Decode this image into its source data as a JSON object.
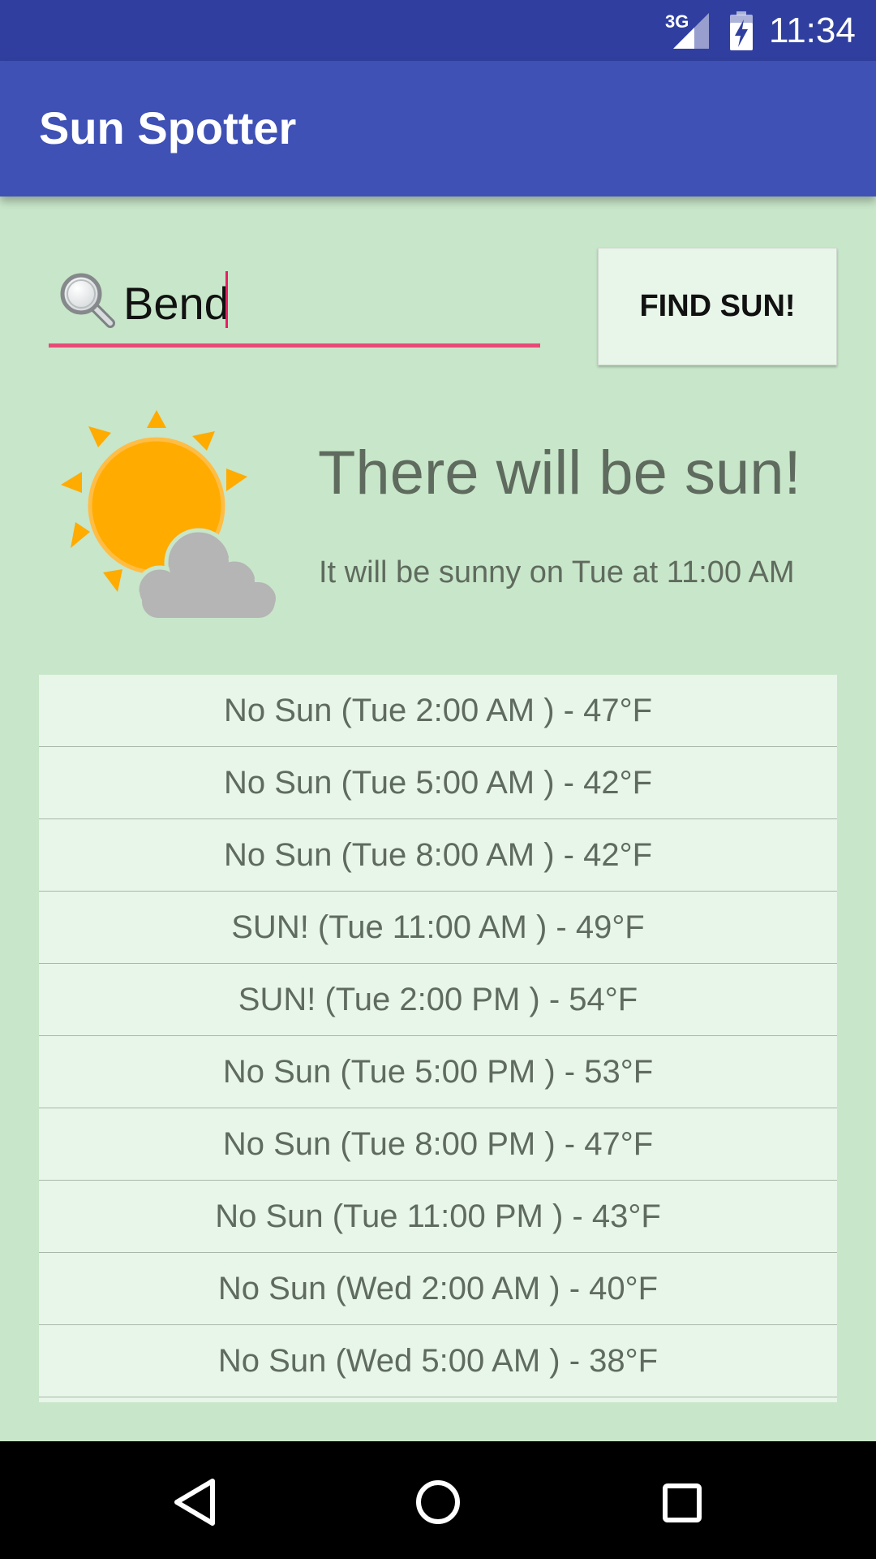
{
  "status_bar": {
    "network": "3G",
    "time": "11:34"
  },
  "app_bar": {
    "title": "Sun Spotter"
  },
  "search": {
    "value": "Bend",
    "icon": "search-icon"
  },
  "find_button": {
    "label": "FIND SUN!"
  },
  "summary": {
    "icon": "sun-behind-cloud-icon",
    "headline": "There will be sun!",
    "detail": "It will be sunny on Tue at 11:00 AM"
  },
  "forecast": [
    "No Sun (Tue 2:00 AM ) - 47°F",
    "No Sun (Tue 5:00 AM ) - 42°F",
    "No Sun (Tue 8:00 AM ) - 42°F",
    "SUN! (Tue 11:00 AM ) - 49°F",
    "SUN! (Tue 2:00 PM ) - 54°F",
    "No Sun (Tue 5:00 PM ) - 53°F",
    "No Sun (Tue 8:00 PM ) - 47°F",
    "No Sun (Tue 11:00 PM ) - 43°F",
    "No Sun (Wed 2:00 AM ) - 40°F",
    "No Sun (Wed 5:00 AM ) - 38°F"
  ],
  "colors": {
    "status_bar": "#303f9f",
    "app_bar": "#3f51b5",
    "background": "#c8e6c9",
    "card": "#e8f5e9",
    "accent": "#e91e63",
    "sun": "#ffab00",
    "cloud": "#b5b5b5"
  },
  "nav_bar": {
    "back_icon": "back-triangle-icon",
    "home_icon": "home-circle-icon",
    "recents_icon": "recents-square-icon"
  }
}
